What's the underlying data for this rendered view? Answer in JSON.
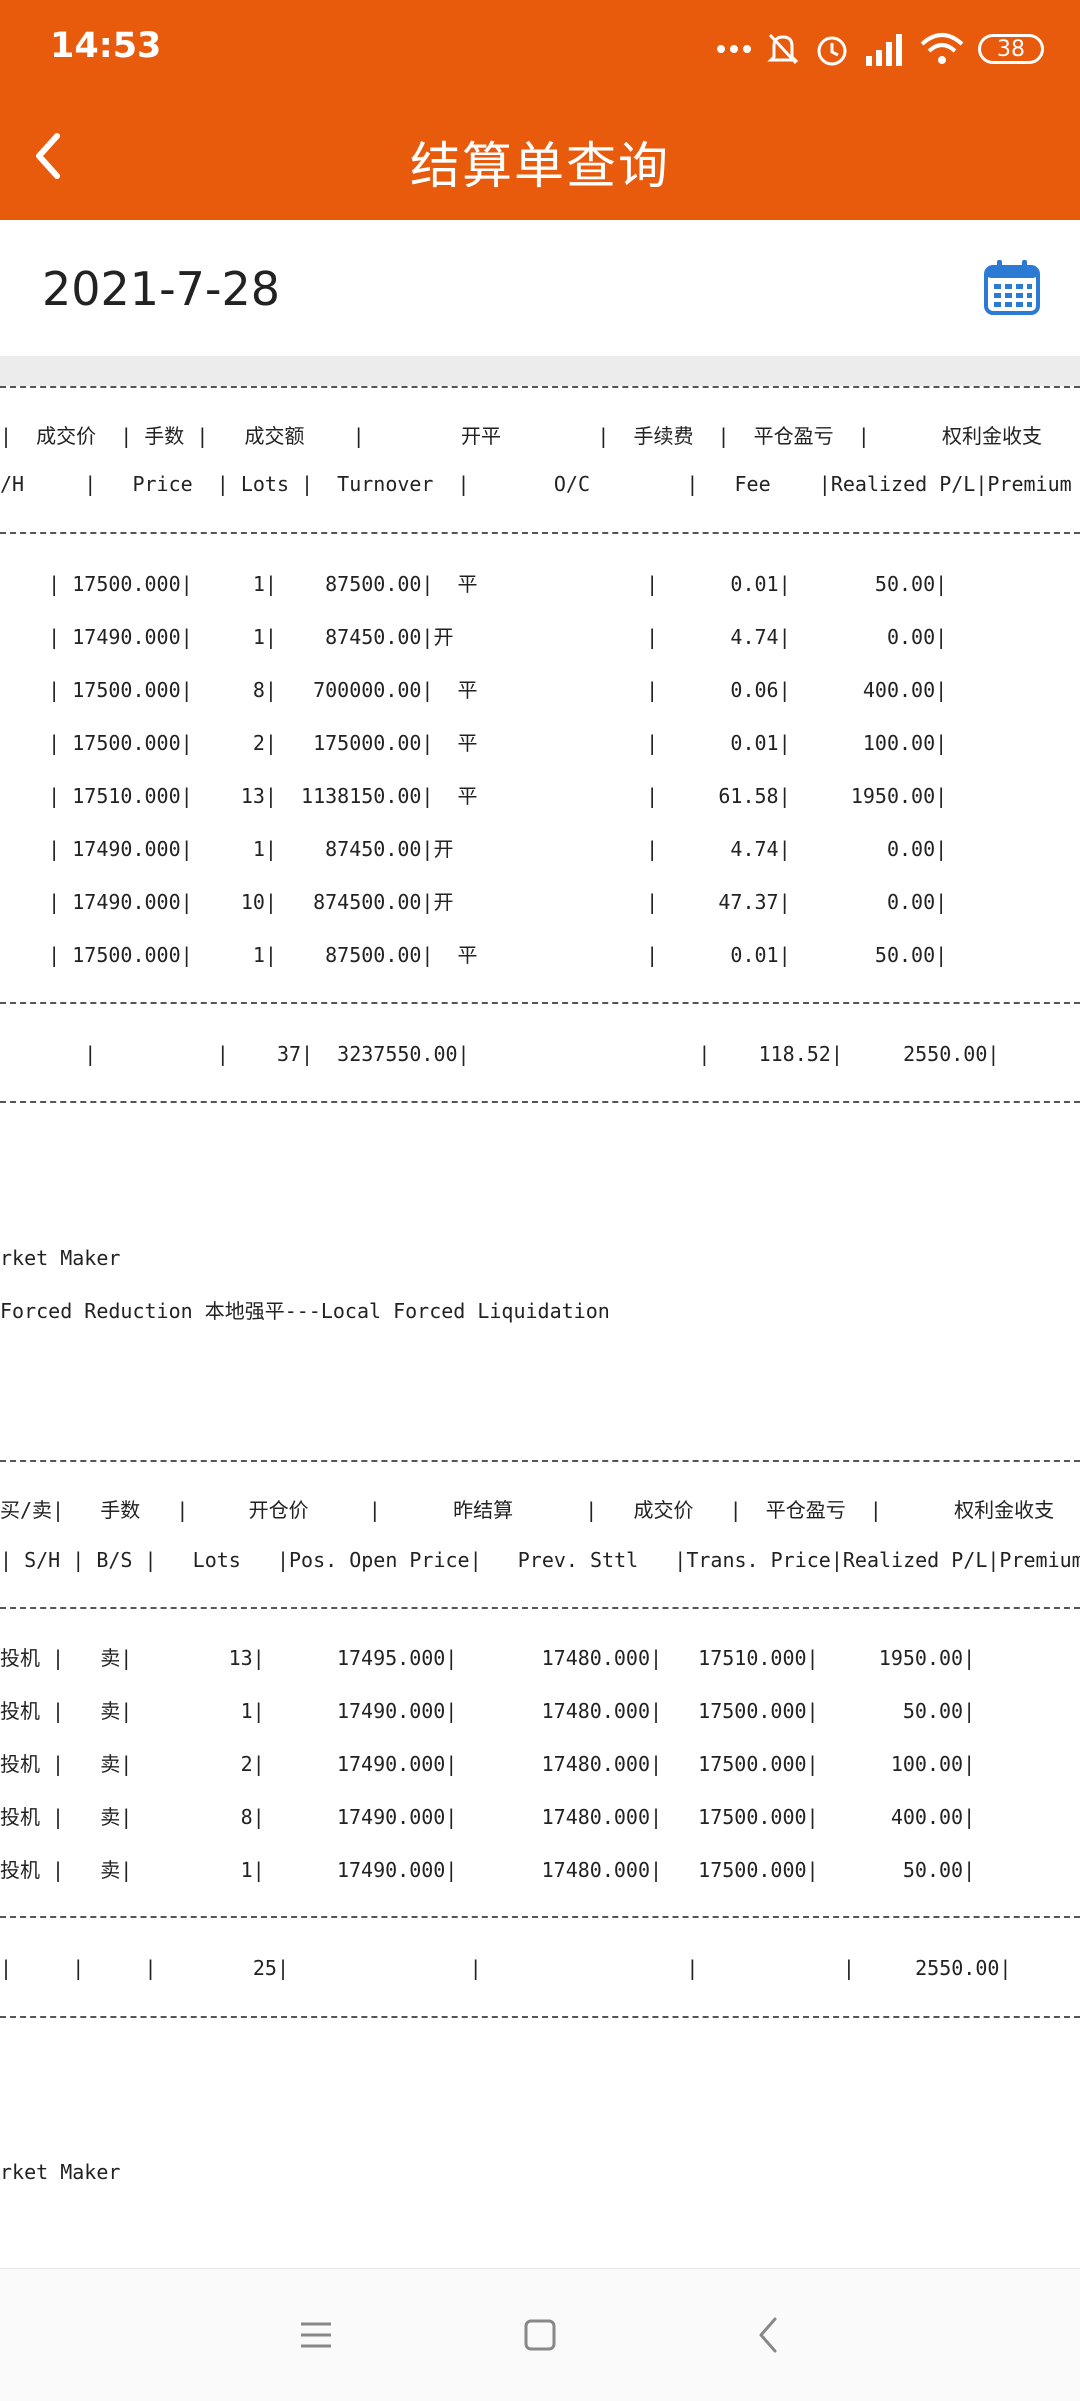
{
  "status": {
    "time": "14:53",
    "battery": "38"
  },
  "app": {
    "title": "结算单查询"
  },
  "date": "2021-7-28",
  "trades": {
    "header_cn": "|  成交价  | 手数 |   成交额    |        开平        |  手续费  |  平仓盈亏  |      权利金收支",
    "header_en": "/H     |   Price  | Lots |  Turnover  |       O/C        |   Fee    |Realized P/L|Premium",
    "rows": [
      "    | 17500.000|     1|    87500.00|  平              |      0.01|       50.00|",
      "    | 17490.000|     1|    87450.00|开                |      4.74|        0.00|",
      "    | 17500.000|     8|   700000.00|  平              |      0.06|      400.00|",
      "    | 17500.000|     2|   175000.00|  平              |      0.01|      100.00|",
      "    | 17510.000|    13|  1138150.00|  平              |     61.58|     1950.00|",
      "    | 17490.000|     1|    87450.00|开                |      4.74|        0.00|",
      "    | 17490.000|    10|   874500.00|开                |     47.37|        0.00|",
      "    | 17500.000|     1|    87500.00|  平              |      0.01|       50.00|"
    ],
    "total": "       |          |    37|  3237550.00|                   |    118.52|     2550.00|"
  },
  "notes1": [
    "rket Maker",
    "Forced Reduction 本地强平---Local Forced Liquidation"
  ],
  "positions": {
    "header_cn": "买/卖|   手数   |     开仓价     |      昨结算      |   成交价   |  平仓盈亏  |      权利金收支       |",
    "header_en": "| S/H | B/S |   Lots   |Pos. Open Price|   Prev. Sttl   |Trans. Price|Realized P/L|Premium",
    "rows": [
      "投机 |   卖|        13|      17495.000|       17480.000|   17510.000|     1950.00|",
      "投机 |   卖|         1|      17490.000|       17480.000|   17500.000|       50.00|",
      "投机 |   卖|         2|      17490.000|       17480.000|   17500.000|      100.00|",
      "投机 |   卖|         8|      17490.000|       17480.000|   17500.000|      400.00|",
      "投机 |   卖|         1|      17490.000|       17480.000|   17500.000|       50.00|"
    ],
    "total": "|     |     |        25|               |                 |            |     2550.00|"
  },
  "notes2": [
    "rket Maker"
  ],
  "colors": {
    "header": "#e85a0c",
    "calendar_icon": "#2b7bd4"
  }
}
